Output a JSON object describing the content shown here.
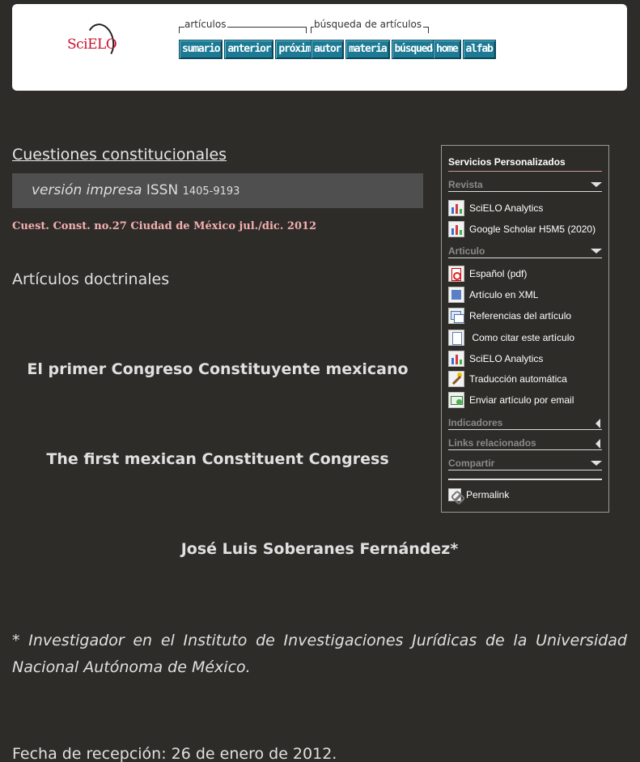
{
  "header": {
    "logo_text": "SciELO",
    "articulos_group": {
      "label": "artículos",
      "buttons": [
        "sumario",
        "anterior",
        "próximo"
      ]
    },
    "busqueda_group": {
      "label": "búsqueda de artículos",
      "buttons": [
        "autor",
        "materia",
        "búsqueda"
      ]
    },
    "extra_buttons": [
      "home",
      "alfab"
    ]
  },
  "main": {
    "journal_title": "Cuestiones constitucionales",
    "issn": {
      "edition": "versión impresa",
      "label": "ISSN",
      "number": "1405-9193"
    },
    "citation": "Cuest. Const.  no.27 Ciudad de México jul./dic. 2012",
    "section": "Artículos doctrinales",
    "title_es": "El primer Congreso Constituyente mexicano",
    "title_en": "The first mexican Constituent Congress",
    "author": "José Luis Soberanes Fernández*",
    "footnote": "* Investigador en el Instituto de Investigaciones Jurídicas de la Universidad Nacional Autónoma de México.",
    "received": "Fecha de recepción: 26 de enero de 2012."
  },
  "sidebar": {
    "title": "Servicios Personalizados",
    "revista": {
      "heading": "Revista",
      "items": [
        "SciELO Analytics",
        "Google Scholar H5M5 (2020)"
      ]
    },
    "articulo": {
      "heading": "Articulo",
      "items": [
        "Español (pdf)",
        "Artículo en XML",
        "Referencias del artículo",
        " Como citar este artículo",
        "SciELO Analytics",
        "Traducción automática",
        "Enviar artículo por email"
      ]
    },
    "indicadores": "Indicadores",
    "links": "Links relacionados",
    "compartir": "Compartir",
    "permalink": "Permalink"
  },
  "colors": {
    "background": "#2e2c29",
    "nav_button": "#1d7a95",
    "citation": "#f4b0b0",
    "issn_bar": "#4f4f4f"
  }
}
